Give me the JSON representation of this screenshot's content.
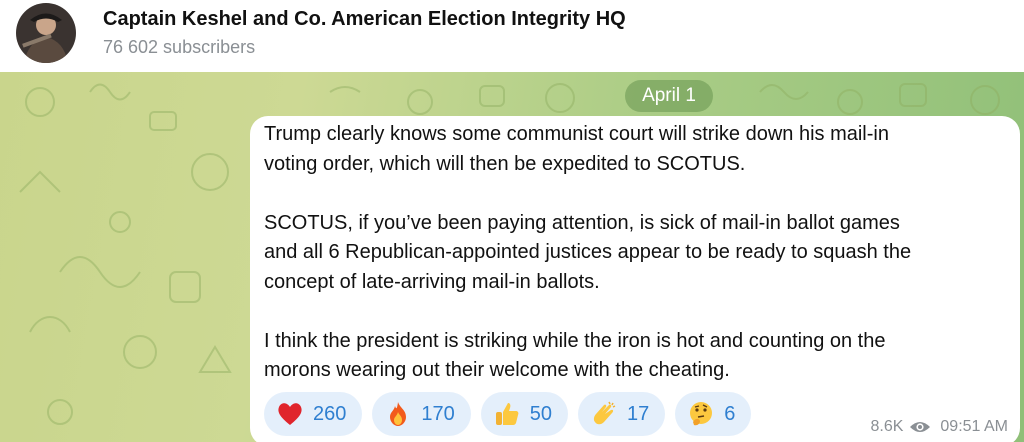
{
  "channel": {
    "title": "Captain Keshel and Co. American Election Integrity HQ",
    "subscribers": "76 602 subscribers",
    "avatar_icon": "channel-avatar"
  },
  "date_label": "April 1",
  "message": {
    "paragraphs": [
      [
        "Trump clearly knows some communist court will strike down his mail-in",
        "voting order, which will then be expedited to SCOTUS."
      ],
      [
        "SCOTUS, if you’ve been paying attention, is sick of mail-in ballot games",
        "and all 6 Republican-appointed justices appear to be ready to squash the",
        "concept of late-arriving mail-in ballots."
      ],
      [
        "I think the president is striking while the iron is hot and counting on the",
        "morons wearing out their welcome with the cheating."
      ]
    ],
    "views": "8.6K",
    "time": "09:51 AM"
  },
  "reactions": [
    {
      "emoji": "red-heart",
      "count": "260"
    },
    {
      "emoji": "fire",
      "count": "170"
    },
    {
      "emoji": "thumbs-up",
      "count": "50"
    },
    {
      "emoji": "clapping-hands",
      "count": "17"
    },
    {
      "emoji": "thinking-face",
      "count": "6"
    }
  ],
  "colors": {
    "accent": "#2f7fd0",
    "reaction_bg": "#e4effb",
    "secondary_text": "#8a8f94"
  }
}
